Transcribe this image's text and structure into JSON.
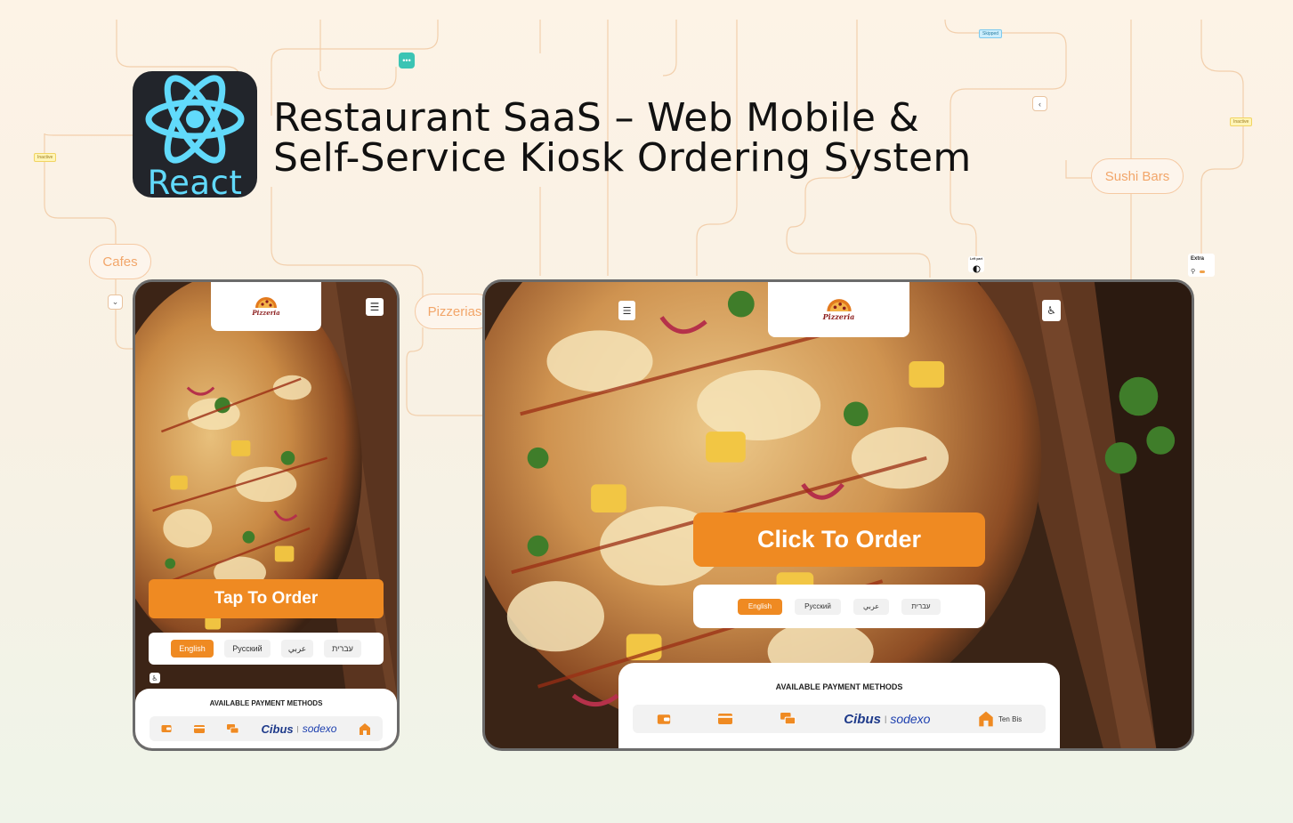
{
  "page": {
    "title_line1": "Restaurant SaaS – Web Mobile &",
    "title_line2": "Self-Service Kiosk Ordering System",
    "react_label": "React"
  },
  "chips": {
    "cafes": "Cafes",
    "pizzerias": "Pizzerias",
    "sushi": "Sushi Bars"
  },
  "tags": {
    "inactive_left": "Inactive",
    "inactive_right": "Inactive",
    "skipped": "Skipped",
    "left_part": "Left part",
    "extra": "Extra"
  },
  "mobile": {
    "brand": "Pizzeria",
    "order_label": "Tap To Order",
    "languages": [
      "English",
      "Русский",
      "عربي",
      "עברית"
    ],
    "active_language": "English",
    "payment_title": "AVAILABLE PAYMENT METHODS",
    "cibus": "Cibus",
    "sodexo": "sodexo"
  },
  "kiosk": {
    "brand": "Pizzeria",
    "order_label": "Click To Order",
    "languages": [
      "English",
      "Русский",
      "عربي",
      "עברית"
    ],
    "active_language": "English",
    "payment_title": "AVAILABLE PAYMENT METHODS",
    "cibus": "Cibus",
    "sodexo": "sodexo",
    "tenbis": "Ten Bis"
  },
  "colors": {
    "accent": "#ef8a22",
    "react_blue": "#61dafb",
    "react_bg": "#22252b",
    "chip_border": "#f5c9a3",
    "device_frame": "#6b6b6b"
  },
  "icons": {
    "menu": "hamburger-icon",
    "accessibility": "accessibility-icon",
    "wallet": "wallet-icon",
    "card": "credit-card-icon",
    "cards": "cards-stack-icon",
    "tenbis": "tenbis-logo-icon"
  }
}
